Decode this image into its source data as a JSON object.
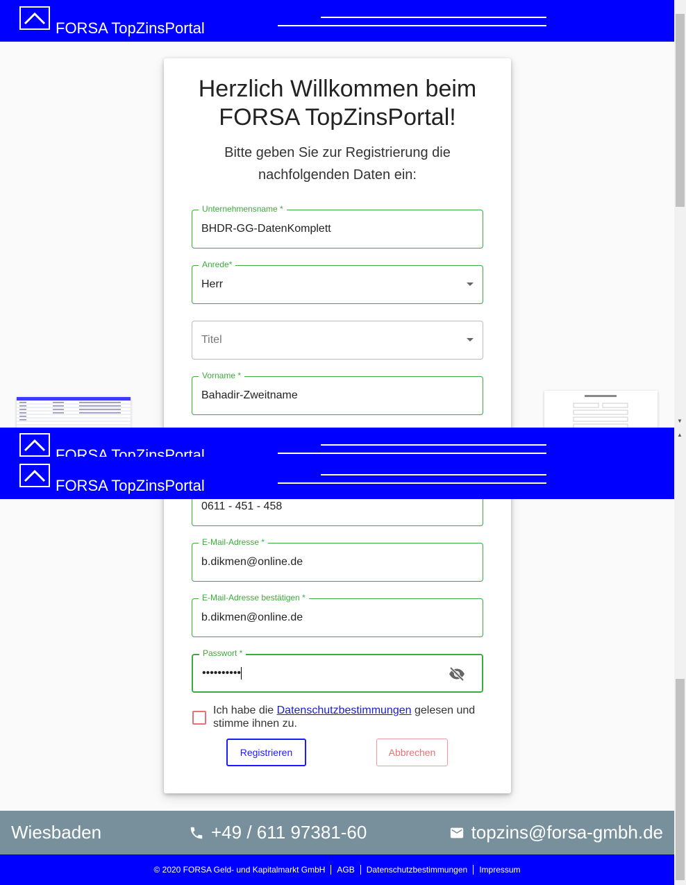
{
  "header": {
    "brand": "FORSA TopZinsPortal"
  },
  "card": {
    "title_line1": "Herzlich Willkommen beim",
    "title_line2": "FORSA TopZinsPortal!",
    "subtitle_line1": "Bitte geben Sie zur Registrierung die",
    "subtitle_line2": "nachfolgenden Daten ein:"
  },
  "form": {
    "company": {
      "label": "Unternehmensname *",
      "value": "BHDR-GG-DatenKomplett"
    },
    "salutation": {
      "label": "Anrede*",
      "value": "Herr"
    },
    "title": {
      "placeholder": "Titel"
    },
    "firstname": {
      "label": "Vorname *",
      "value": "Bahadir-Zweitname"
    },
    "phone": {
      "value": "0611 - 451 - 458"
    },
    "email": {
      "label": "E-Mail-Adresse *",
      "value": "b.dikmen@online.de"
    },
    "email_confirm": {
      "label": "E-Mail-Adresse bestätigen *",
      "value": "b.dikmen@online.de"
    },
    "password": {
      "label": "Passwort *",
      "value": "••••••••••"
    },
    "consent_before": "Ich habe die ",
    "consent_link": "Datenschutzbestimmungen",
    "consent_after": " gelesen und stimme ihnen zu.",
    "register_label": "Registrieren",
    "cancel_label": "Abbrechen"
  },
  "footer": {
    "city": "Wiesbaden",
    "phone": "+49 / 611 97381-60",
    "email": "topzins@forsa-gmbh.de",
    "copyright": "© 2020 FORSA Geld- und Kapitalmarkt GmbH",
    "agb": "AGB",
    "privacy": "Datenschutzbestimmungen",
    "imprint": "Impressum"
  },
  "colors": {
    "brand_blue": "#0000ff",
    "valid_green": "#3bab3b",
    "footer_grey": "#78909c",
    "error_red": "#e57373"
  },
  "icons": [
    "logo-chevron-up-icon",
    "dropdown-caret-icon",
    "eye-off-icon",
    "phone-icon",
    "mail-icon"
  ]
}
